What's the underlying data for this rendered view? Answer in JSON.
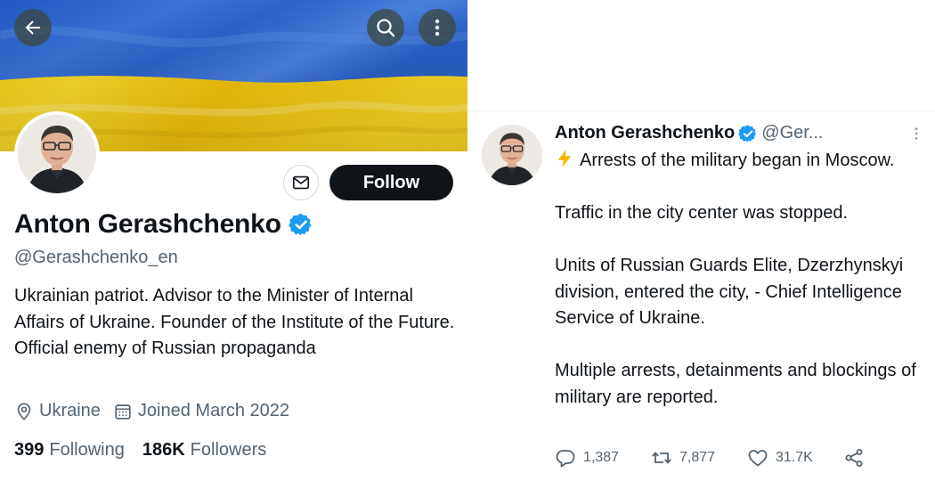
{
  "profile": {
    "display_name": "Anton Gerashchenko",
    "handle": "@Gerashchenko_en",
    "bio": "Ukrainian patriot. Advisor to the Minister of Internal Affairs of Ukraine. Founder of the Institute of the Future. Official enemy of Russian propaganda",
    "location": "Ukraine",
    "joined": "Joined March 2022",
    "following_count": "399",
    "following_label": "Following",
    "followers_count": "186K",
    "followers_label": "Followers",
    "follow_label": "Follow",
    "verified": true
  },
  "tweet": {
    "author_name": "Anton Gerashchenko",
    "author_handle": "@Ger...",
    "text": "Arrests of the military began in Moscow.\n\nTraffic in the city center was stopped.\n\nUnits of Russian Guards Elite, Dzerzhynskyi division, entered the city, - Chief Intelligence Service of Ukraine.\n\nMultiple arrests, detainments and blockings of military are reported.",
    "replies": "1,387",
    "retweets": "7,877",
    "likes": "31.7K"
  },
  "icons": {
    "back": "arrow-left-icon",
    "search": "search-icon",
    "more": "more-vertical-icon",
    "message": "envelope-icon",
    "verified": "verified-badge-icon",
    "location": "location-pin-icon",
    "calendar": "calendar-icon",
    "reply": "reply-icon",
    "retweet": "retweet-icon",
    "like": "heart-icon",
    "share": "share-icon",
    "bolt": "lightning-icon"
  },
  "colors": {
    "flag_blue": "#2f63c8",
    "flag_yellow": "#f6d21a",
    "verified_blue": "#1d9bf0",
    "text_primary": "#0f1419",
    "text_secondary": "#536471",
    "follow_bg": "#0f1419"
  }
}
